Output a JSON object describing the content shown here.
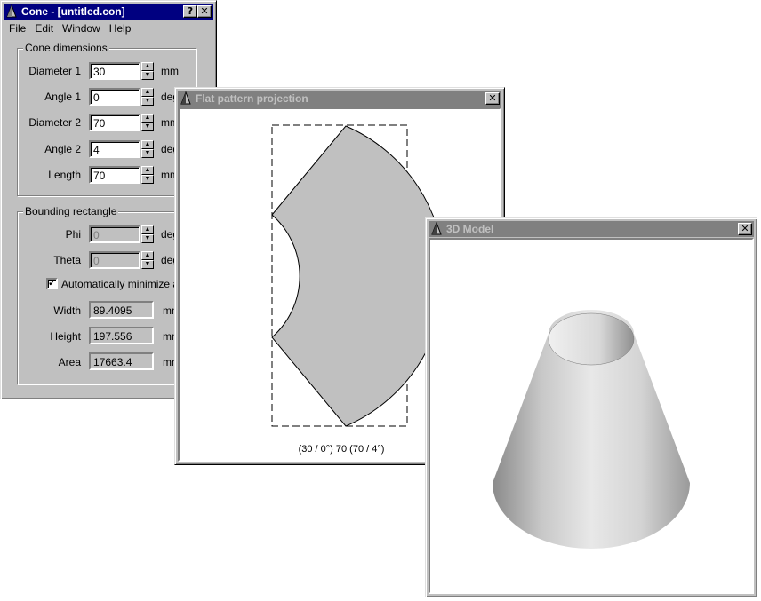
{
  "main_window": {
    "title": "Cone - [untitled.con]",
    "help_btn": "?",
    "close_btn": "✕",
    "menu": [
      "File",
      "Edit",
      "Window",
      "Help"
    ],
    "cone_group": {
      "label": "Cone dimensions",
      "fields": [
        {
          "label": "Diameter 1",
          "value": "30",
          "unit": "mm"
        },
        {
          "label": "Angle 1",
          "value": "0",
          "unit": "deg"
        },
        {
          "label": "Diameter 2",
          "value": "70",
          "unit": "mm"
        },
        {
          "label": "Angle 2",
          "value": "4",
          "unit": "deg"
        },
        {
          "label": "Length",
          "value": "70",
          "unit": "mm"
        }
      ]
    },
    "bounding_group": {
      "label": "Bounding rectangle",
      "phi": {
        "label": "Phi",
        "value": "0",
        "unit": "deg"
      },
      "theta": {
        "label": "Theta",
        "value": "0",
        "unit": "deg"
      },
      "auto_minimize": {
        "label": "Automatically minimize area",
        "checked": true,
        "mark": "✓"
      },
      "width": {
        "label": "Width",
        "value": "89.4095",
        "unit": "mm"
      },
      "height": {
        "label": "Height",
        "value": "197.556",
        "unit": "mm"
      },
      "area": {
        "label": "Area",
        "value": "17663.4",
        "unit": "mm"
      }
    }
  },
  "flat_window": {
    "title": "Flat pattern projection",
    "close_btn": "✕",
    "caption": "(30 / 0°) 70 (70 / 4°)",
    "fill_color": "#c0c0c0"
  },
  "model_window": {
    "title": "3D Model",
    "close_btn": "✕"
  }
}
